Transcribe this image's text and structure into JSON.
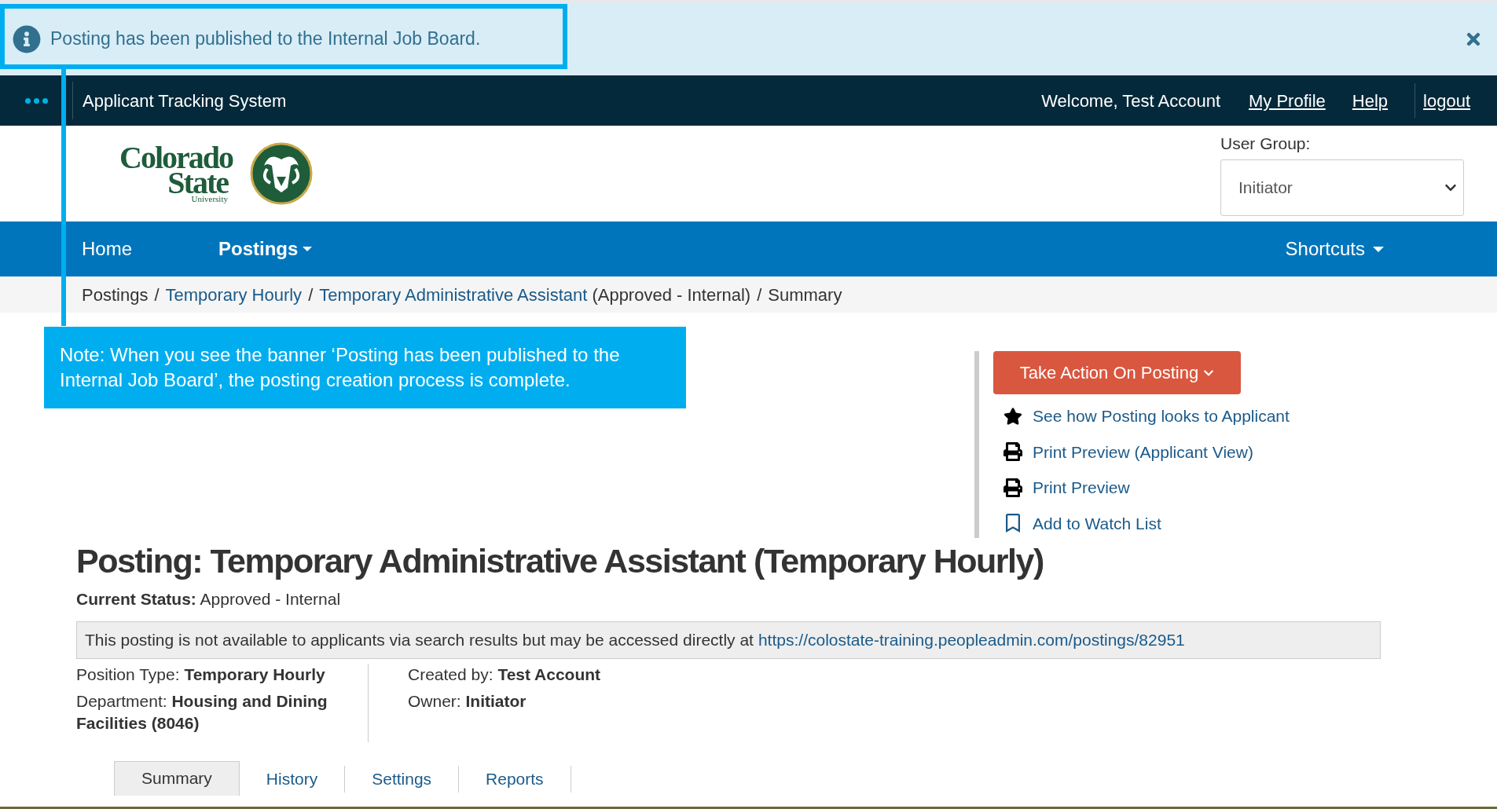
{
  "alert": {
    "message": "Posting has been published to the Internal Job Board."
  },
  "topbar": {
    "app_name": "Applicant Tracking System",
    "welcome": "Welcome, Test Account",
    "links": [
      "My Profile",
      "Help",
      "logout"
    ]
  },
  "logo": {
    "lines": [
      "Colorado",
      "State",
      "University"
    ]
  },
  "user_group": {
    "label": "User Group:",
    "value": "Initiator"
  },
  "nav": {
    "items": [
      {
        "label": "Home",
        "dropdown": false,
        "selected": false
      },
      {
        "label": "Postings",
        "dropdown": true,
        "selected": true
      }
    ],
    "shortcuts": "Shortcuts"
  },
  "breadcrumb": [
    {
      "label": "Postings",
      "link": false
    },
    {
      "separator": "/",
      "label": "Temporary Hourly",
      "link": true
    },
    {
      "separator": "/",
      "label": "Temporary Administrative Assistant",
      "link": true,
      "suffix": "(Approved - Internal)"
    },
    {
      "separator": "/",
      "label": "Summary",
      "link": false
    }
  ],
  "annotation": {
    "note": "Note: When you see the banner ‘Posting has been published to the Internal Job Board’, the posting creation process is complete."
  },
  "actions": {
    "button": "Take Action On Posting",
    "links": [
      {
        "label": "See how Posting looks to Applicant",
        "kind": "star"
      },
      {
        "label": "Print Preview (Applicant View)",
        "kind": "print"
      },
      {
        "label": "Print Preview",
        "kind": "print"
      },
      {
        "label": "Add to Watch List",
        "kind": "bookmark"
      }
    ]
  },
  "posting": {
    "title": "Posting: Temporary Administrative Assistant (Temporary Hourly)",
    "status": "**Current Status:** Approved - Internal",
    "notice": "This posting is not available to applicants via search results but may be accessed directly at",
    "url": "https://colostate-training.peopleadmin.com/postings/82951",
    "details_left": [
      "Position Type: **Temporary Hourly**",
      "Department: **Housing and Dining Facilities (8046)**"
    ],
    "details_right": [
      "Created by: **Test Account**",
      "Owner: **Initiator**"
    ]
  },
  "tabs": [
    {
      "label": "Summary",
      "selected": true
    },
    {
      "label": "History",
      "selected": false
    },
    {
      "label": "Settings",
      "selected": false
    },
    {
      "label": "Reports",
      "selected": false
    }
  ]
}
